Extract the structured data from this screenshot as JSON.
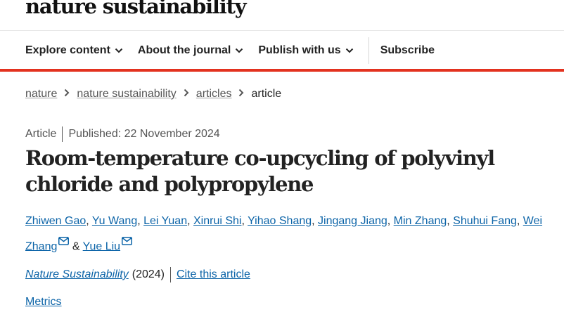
{
  "header": {
    "logo_text": "nature sustainability",
    "nav": [
      {
        "label": "Explore content",
        "icon": "chevron-down-icon"
      },
      {
        "label": "About the journal",
        "icon": "chevron-down-icon"
      },
      {
        "label": "Publish with us",
        "icon": "chevron-down-icon"
      },
      {
        "label": "Subscribe"
      }
    ],
    "accent_color": "#e3321f"
  },
  "breadcrumb": {
    "items": [
      "nature",
      "nature sustainability",
      "articles"
    ],
    "current": "article"
  },
  "article": {
    "type": "Article",
    "published": "Published: 22 November 2024",
    "title": "Room-temperature co-upcycling of polyvinyl chloride and polypropylene",
    "authors": [
      "Zhiwen Gao",
      "Yu Wang",
      "Lei Yuan",
      "Xinrui Shi",
      "Yihao Shang",
      "Jingang Jiang",
      "Min Zhang",
      "Shuhui Fang",
      "Wei Zhang",
      "Yue Liu"
    ],
    "ampersand": "&",
    "journal": "Nature Sustainability",
    "year": "(2024)",
    "cite_label": "Cite this article",
    "metrics_label": "Metrics",
    "link_color": "#0c64a8"
  }
}
